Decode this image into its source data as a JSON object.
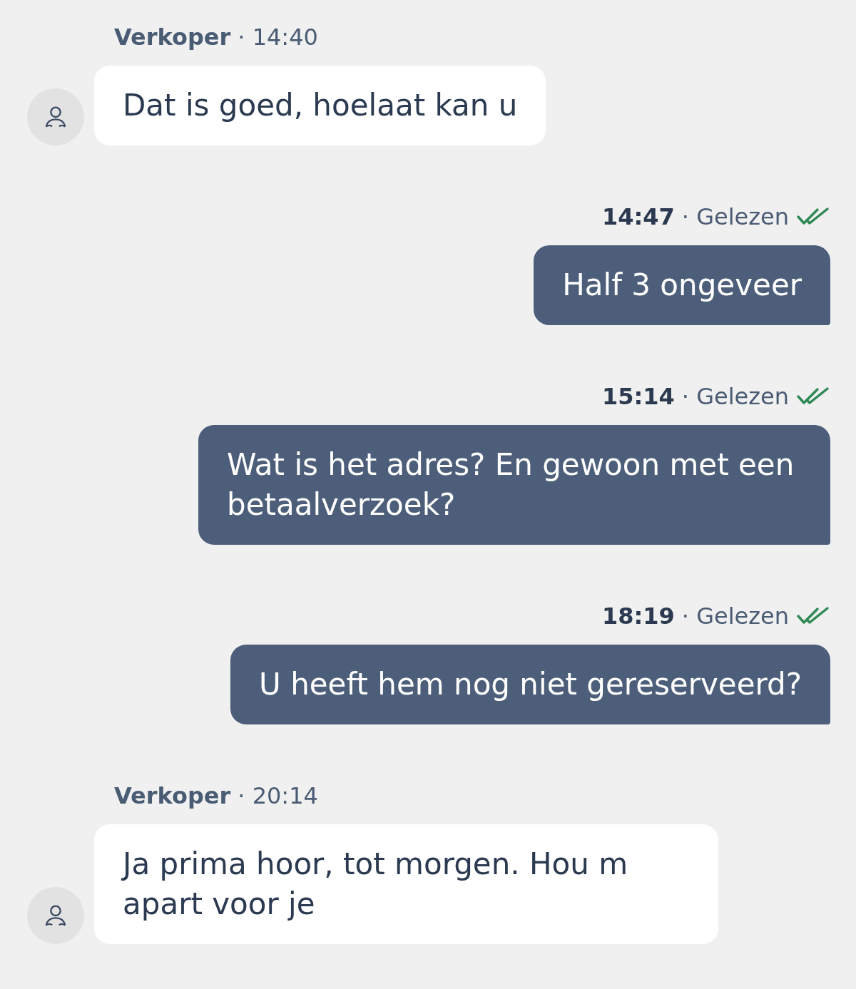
{
  "messages": [
    {
      "kind": "incoming",
      "sender": "Verkoper",
      "time": "· 14:40",
      "text": "Dat is goed, hoelaat kan u"
    },
    {
      "kind": "outgoing",
      "time": "14:47",
      "status": "· Gelezen",
      "read": true,
      "text": "Half 3 ongeveer"
    },
    {
      "kind": "outgoing",
      "time": "15:14",
      "status": "· Gelezen",
      "read": true,
      "text": "Wat is het adres? En gewoon met een betaalverzoek?"
    },
    {
      "kind": "outgoing",
      "time": "18:19",
      "status": "· Gelezen",
      "read": true,
      "text": "U heeft hem nog niet gereserveerd?"
    },
    {
      "kind": "incoming",
      "sender": "Verkoper",
      "time": "· 20:14",
      "text": "Ja prima hoor, tot morgen. Hou m apart voor je"
    }
  ]
}
